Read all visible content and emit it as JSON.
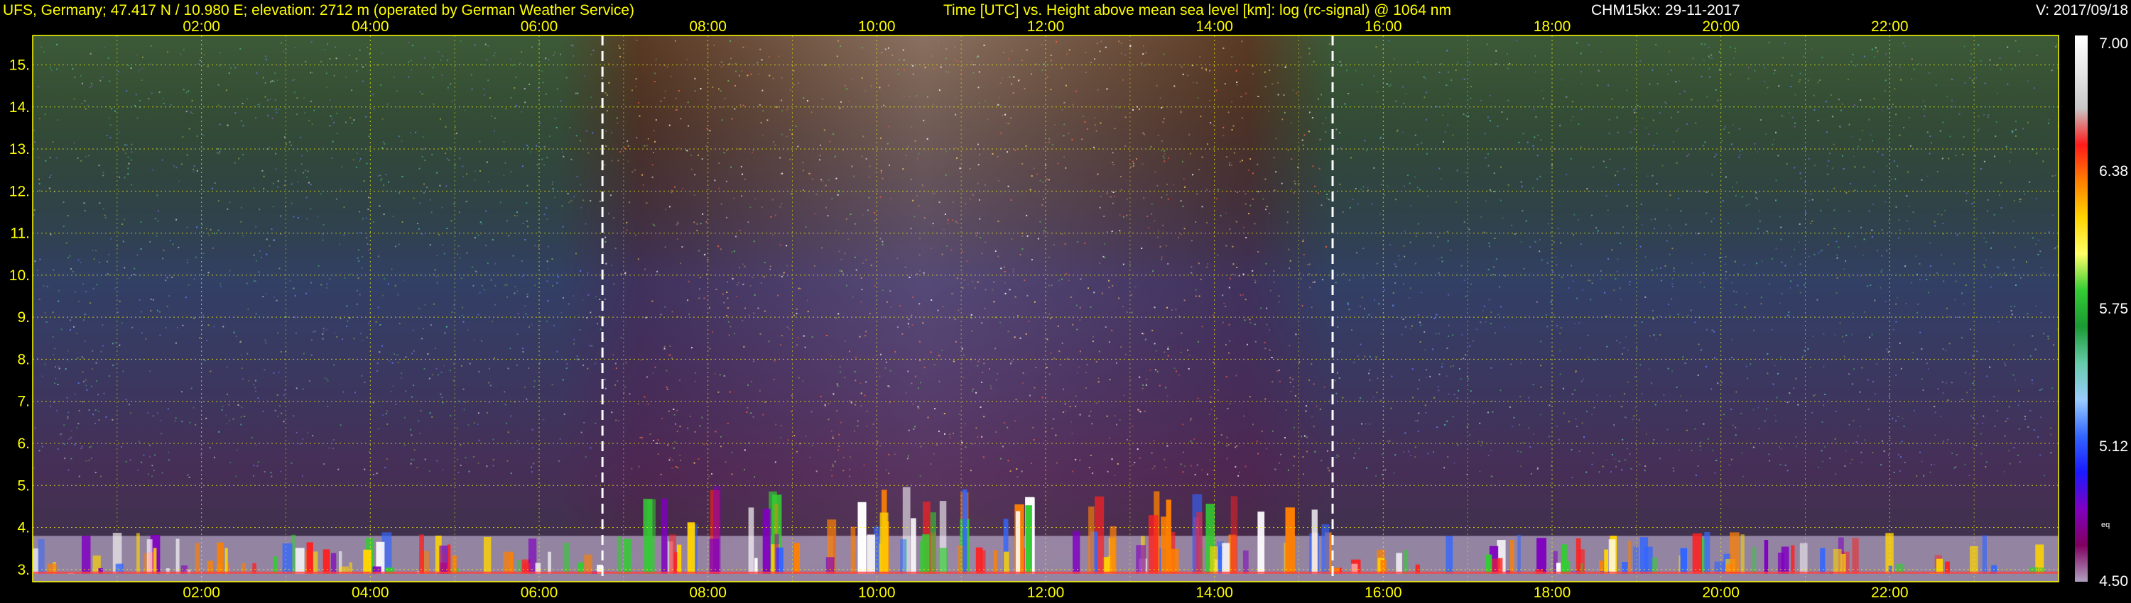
{
  "header": {
    "site": "UFS, Germany; 47.417 N / 10.980 E; elevation: 2712 m  (operated by German Weather Service)",
    "description": "Time [UTC] vs. Height above mean sea level [km]: log (rc-signal) @ 1064 nm",
    "instrument_date": "CHM15kx: 29-11-2017",
    "version": "V: 2017/09/18"
  },
  "colors": {
    "background": "#000000",
    "header_text": "#ffff00",
    "header_text_white": "#ffffff",
    "axis_text": "#ffff00",
    "grid": "#ffff00",
    "frame": "#ffff00",
    "markers": "#ffffff"
  },
  "chart_data": {
    "type": "heatmap",
    "x_label": "Time [UTC]",
    "y_label": "Height above mean sea level [km]",
    "xlim_hours": [
      0.0,
      24.0
    ],
    "ylim_km": [
      2.71,
      15.7
    ],
    "x_ticks": [
      "02:00",
      "04:00",
      "06:00",
      "08:00",
      "10:00",
      "12:00",
      "14:00",
      "16:00",
      "18:00",
      "20:00",
      "22:00"
    ],
    "x_tick_hours": [
      2,
      4,
      6,
      8,
      10,
      12,
      14,
      16,
      18,
      20,
      22
    ],
    "y_ticks": [
      "3.",
      "4.",
      "5.",
      "6.",
      "7.",
      "8.",
      "9.",
      "10.",
      "11.",
      "12.",
      "13.",
      "14.",
      "15."
    ],
    "y_tick_values": [
      3,
      4,
      5,
      6,
      7,
      8,
      9,
      10,
      11,
      12,
      13,
      14,
      15
    ],
    "grid": true,
    "vertical_markers_hours": [
      6.75,
      15.4
    ],
    "colorbar": {
      "range": [
        4.5,
        7.0
      ],
      "tick_labels": [
        "7.00",
        "6.38",
        "5.75",
        "5.12",
        "4.50"
      ],
      "tick_values": [
        7.0,
        6.38,
        5.75,
        5.12,
        4.5
      ],
      "annotation": "eq",
      "stops": [
        "#ffffff",
        "#e6e6e6",
        "#c8c8c8",
        "#ff1a1a",
        "#ff8000",
        "#ffd400",
        "#ffff66",
        "#33cc33",
        "#1a9933",
        "#66ccaa",
        "#99ccff",
        "#3366ff",
        "#1a1aff",
        "#8000c0",
        "#800060",
        "#b0a0c0"
      ]
    },
    "daytime_hours": [
      6.75,
      15.4
    ],
    "cloud_top_km_day": 5.0,
    "cloud_top_km_night": 3.8
  }
}
